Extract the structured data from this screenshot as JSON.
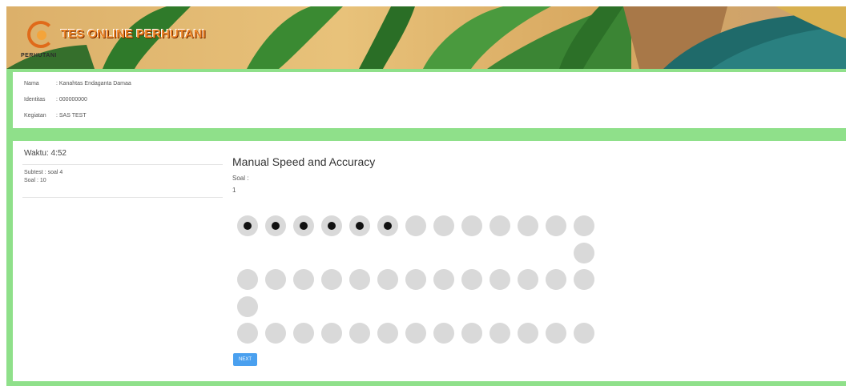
{
  "header": {
    "logo_title": "TES ONLINE PERHUTANI",
    "logo_sub": "PERHUTANI",
    "logo_icon": "perhutani-logo-icon"
  },
  "participant": {
    "name_label": "Nama",
    "name_value": ": Kanahtas Endaganta Damaa",
    "id_label": "Identitas",
    "id_value": ": 000000000",
    "event_label": "Kegiatan",
    "event_value": ": SAS TEST"
  },
  "sidebar": {
    "timer": "Waktu: 4:52",
    "subtest": "Subtest : soal 4",
    "soal": "Soal : 10"
  },
  "question": {
    "title": "Manual Speed and Accuracy",
    "soal_label": "Soal :",
    "soal_value": "1",
    "dot_rows": [
      {
        "count": 13,
        "filled": 6
      },
      {
        "count": 1,
        "filled": 0
      },
      {
        "count": 13,
        "filled": 0
      },
      {
        "count": 1,
        "filled": 0
      },
      {
        "count": 13,
        "filled": 0
      }
    ],
    "next_label": "NEXT"
  },
  "colors": {
    "frame_green": "#8fe08a",
    "dot_gray": "#d9d9d9",
    "dot_fill": "#111111",
    "button_blue": "#4aa0ef",
    "logo_orange": "#f08a2a"
  }
}
